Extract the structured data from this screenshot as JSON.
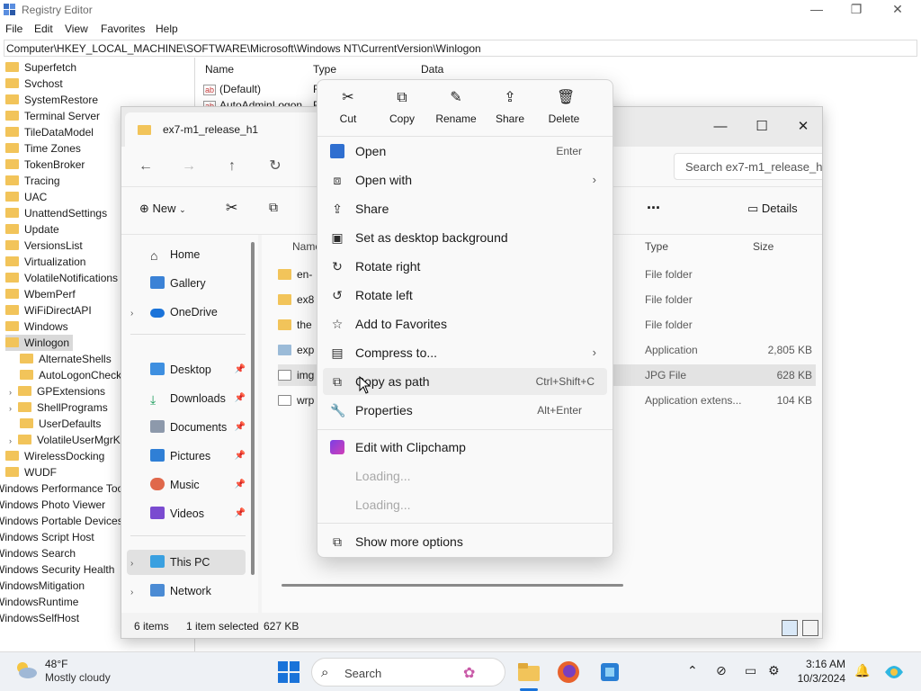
{
  "registry": {
    "title": "Registry Editor",
    "menu": [
      "File",
      "Edit",
      "View",
      "Favorites",
      "Help"
    ],
    "address": "Computer\\HKEY_LOCAL_MACHINE\\SOFTWARE\\Microsoft\\Windows NT\\CurrentVersion\\Winlogon",
    "tree_items": [
      "Superfetch",
      "Svchost",
      "SystemRestore",
      "Terminal Server",
      "TileDataModel",
      "Time Zones",
      "TokenBroker",
      "Tracing",
      "UAC",
      "UnattendSettings",
      "Update",
      "VersionsList",
      "Virtualization",
      "VolatileNotifications",
      "WbemPerf",
      "WiFiDirectAPI",
      "Windows",
      "Winlogon"
    ],
    "winlogon_children": [
      "AlternateShells",
      "AutoLogonChecked",
      "GPExtensions",
      "ShellPrograms",
      "UserDefaults",
      "VolatileUserMgrKey"
    ],
    "tree_items_after": [
      "WirelessDocking",
      "WUDF"
    ],
    "tree_items_outer": [
      "Windows Performance Toolkit",
      "Windows Photo Viewer",
      "Windows Portable Devices",
      "Windows Script Host",
      "Windows Search",
      "Windows Security Health",
      "WindowsMitigation",
      "WindowsRuntime",
      "WindowsSelfHost"
    ],
    "columns": [
      "Name",
      "Type",
      "Data"
    ],
    "values": [
      {
        "name": "(Default)",
        "type": "R"
      },
      {
        "name": "AutoAdminLogon",
        "type": "R"
      }
    ]
  },
  "explorer": {
    "tab_title": "ex7-m1_release_h1",
    "search_placeholder": "Search ex7-m1_release_h",
    "toolbar": {
      "new_label": "New",
      "more_label": "...",
      "details_label": "Details"
    },
    "sidebar": {
      "home": "Home",
      "gallery": "Gallery",
      "onedrive": "OneDrive",
      "desktop": "Desktop",
      "downloads": "Downloads",
      "documents": "Documents",
      "pictures": "Pictures",
      "music": "Music",
      "videos": "Videos",
      "thispc": "This PC",
      "network": "Network"
    },
    "columns": {
      "name": "Name",
      "type": "Type",
      "size": "Size"
    },
    "files": [
      {
        "name": "en-",
        "type": "File folder",
        "size": "",
        "icon": "folder"
      },
      {
        "name": "ex8",
        "type": "File folder",
        "size": "",
        "icon": "folder"
      },
      {
        "name": "the",
        "type": "File folder",
        "size": "",
        "icon": "folder"
      },
      {
        "name": "exp",
        "type": "Application",
        "size": "2,805 KB",
        "icon": "application"
      },
      {
        "name": "img",
        "type": "JPG File",
        "size": "628 KB",
        "icon": "image"
      },
      {
        "name": "wrp",
        "type": "Application extens...",
        "size": "104 KB",
        "icon": "dll"
      }
    ],
    "status": {
      "count": "6 items",
      "selected": "1 item selected",
      "size": "627 KB"
    }
  },
  "context_menu": {
    "top_actions": [
      "Cut",
      "Copy",
      "Rename",
      "Share",
      "Delete"
    ],
    "items": [
      {
        "label": "Open",
        "shortcut": "Enter",
        "arrow": false
      },
      {
        "label": "Open with",
        "shortcut": "",
        "arrow": true
      },
      {
        "label": "Share",
        "shortcut": "",
        "arrow": false
      },
      {
        "label": "Set as desktop background",
        "shortcut": "",
        "arrow": false
      },
      {
        "label": "Rotate right",
        "shortcut": "",
        "arrow": false
      },
      {
        "label": "Rotate left",
        "shortcut": "",
        "arrow": false
      },
      {
        "label": "Add to Favorites",
        "shortcut": "",
        "arrow": false
      },
      {
        "label": "Compress to...",
        "shortcut": "",
        "arrow": true
      },
      {
        "label": "Copy as path",
        "shortcut": "Ctrl+Shift+C",
        "arrow": false
      },
      {
        "label": "Properties",
        "shortcut": "Alt+Enter",
        "arrow": false
      }
    ],
    "extra_items": [
      "Edit with Clipchamp",
      "Loading...",
      "Loading...",
      "Show more options"
    ]
  },
  "taskbar": {
    "weather_temp": "48°F",
    "weather_desc": "Mostly cloudy",
    "search_label": "Search",
    "time": "3:16 AM",
    "date": "10/3/2024"
  }
}
